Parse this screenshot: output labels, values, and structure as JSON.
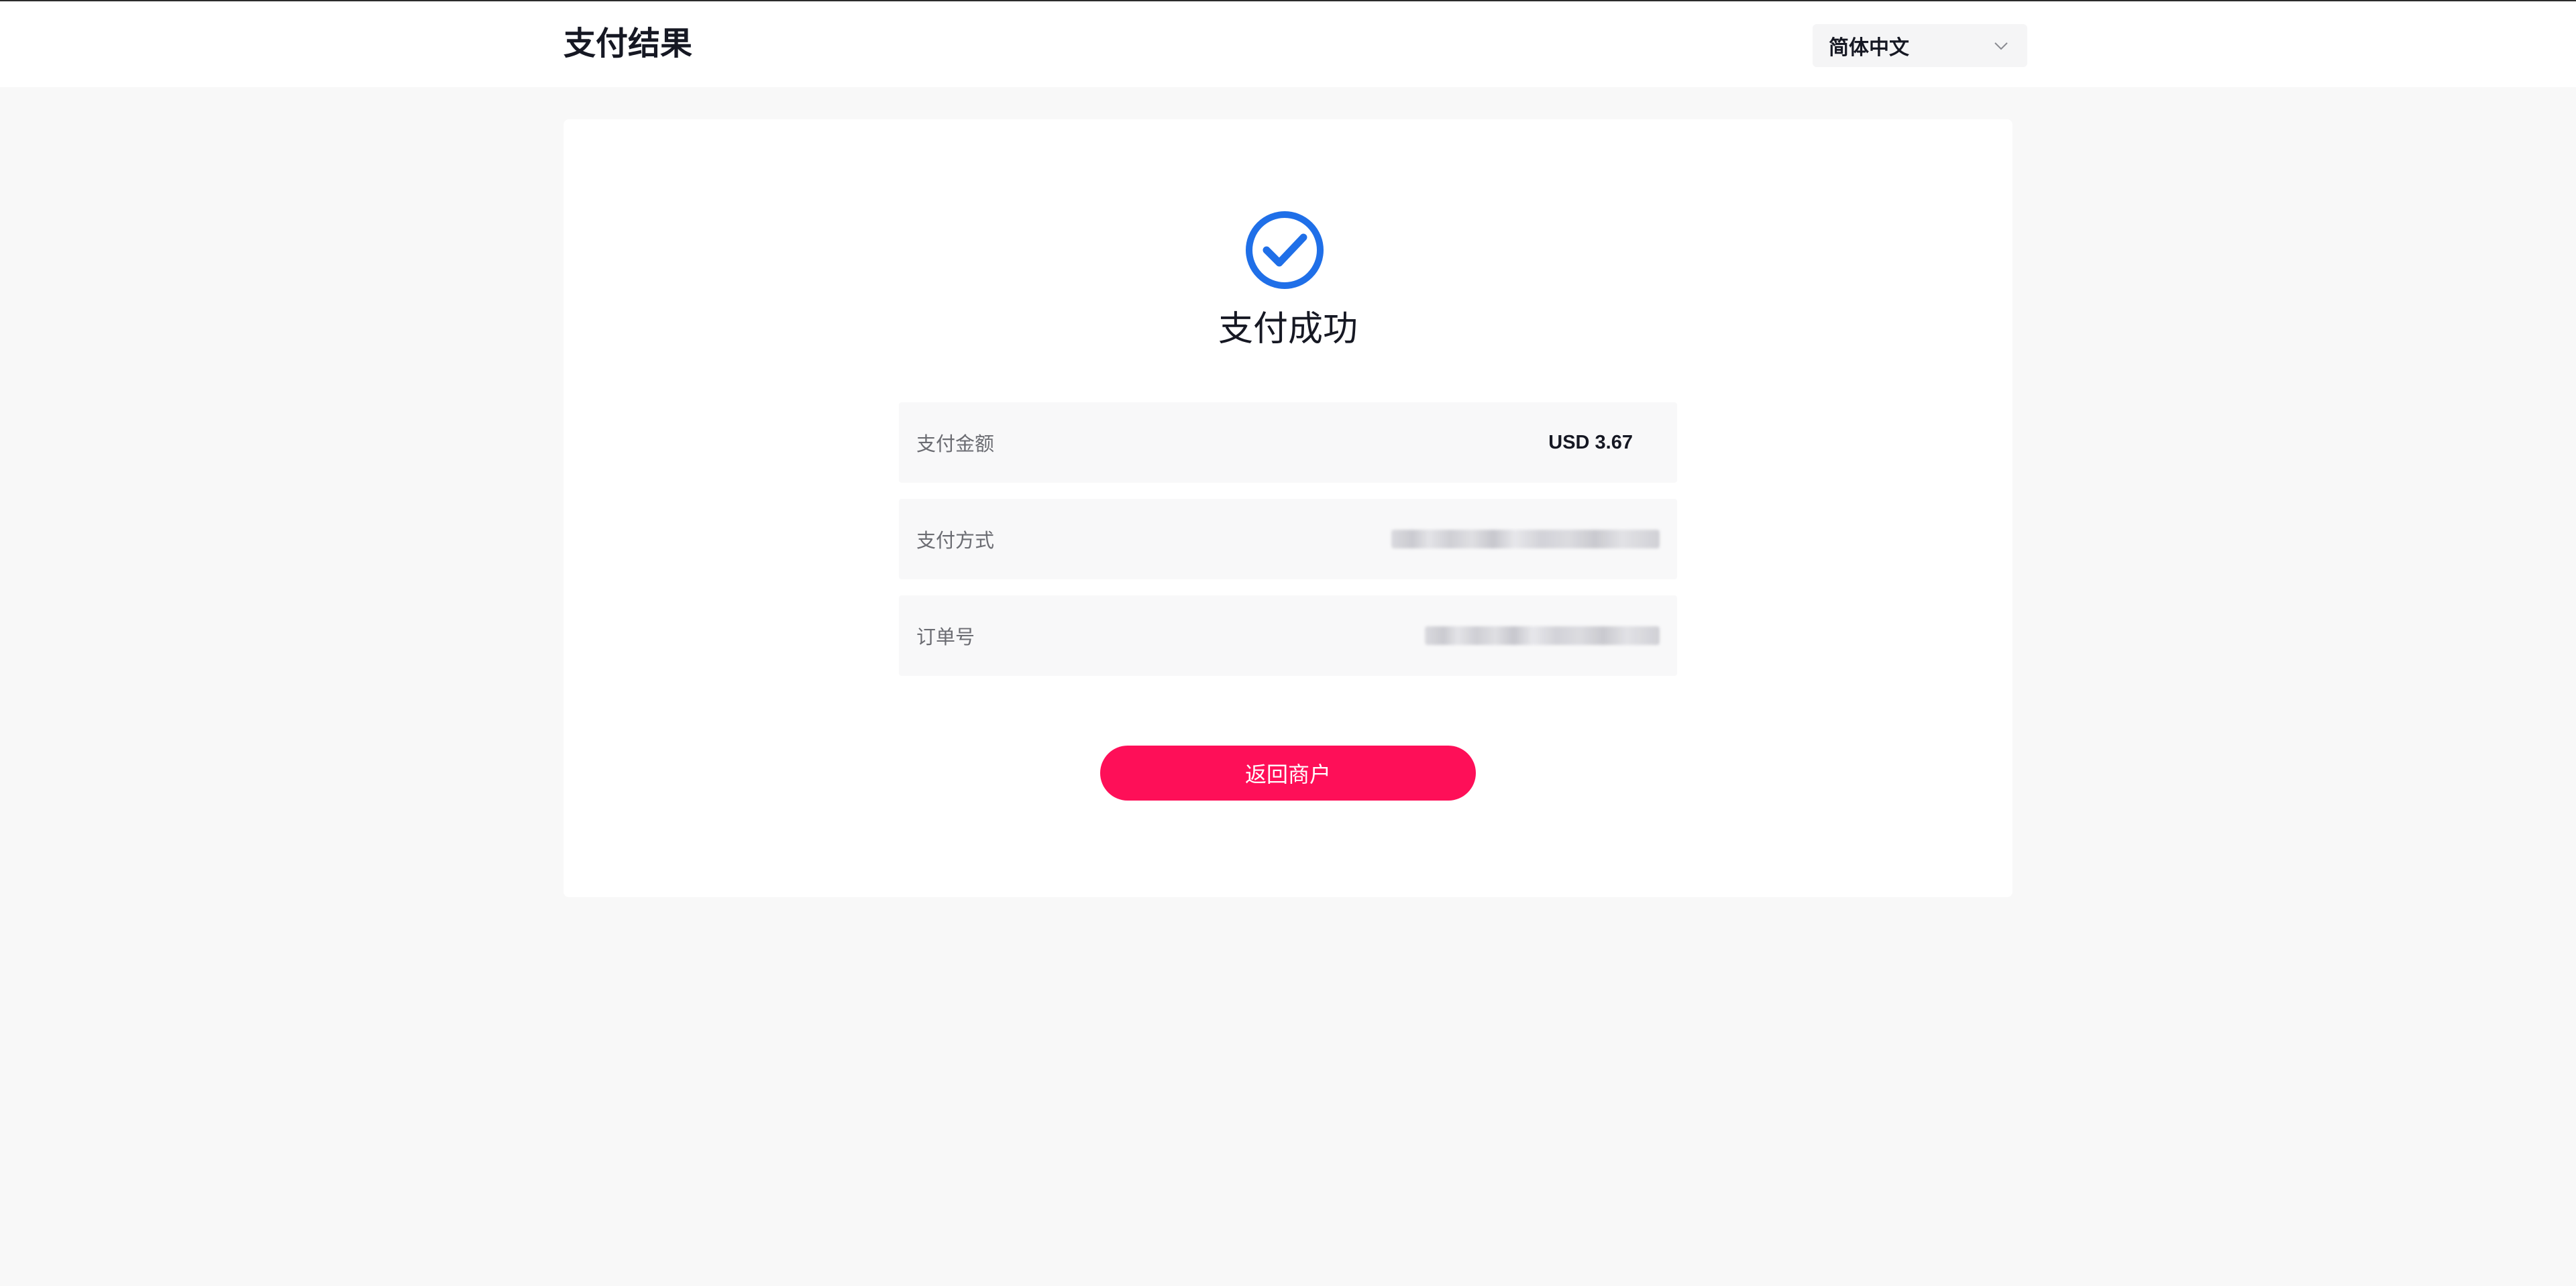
{
  "header": {
    "title": "支付结果",
    "language_selector": {
      "selected": "简体中文"
    }
  },
  "result": {
    "status_title": "支付成功",
    "rows": [
      {
        "label": "支付金额",
        "value": "USD 3.67"
      },
      {
        "label": "支付方式",
        "value": ""
      },
      {
        "label": "订单号",
        "value": ""
      }
    ],
    "return_button_label": "返回商户"
  },
  "colors": {
    "accent_blue": "#1f6fe8",
    "button_red": "#fe0f58",
    "text_primary": "#161823",
    "text_secondary": "#6b6c72"
  }
}
